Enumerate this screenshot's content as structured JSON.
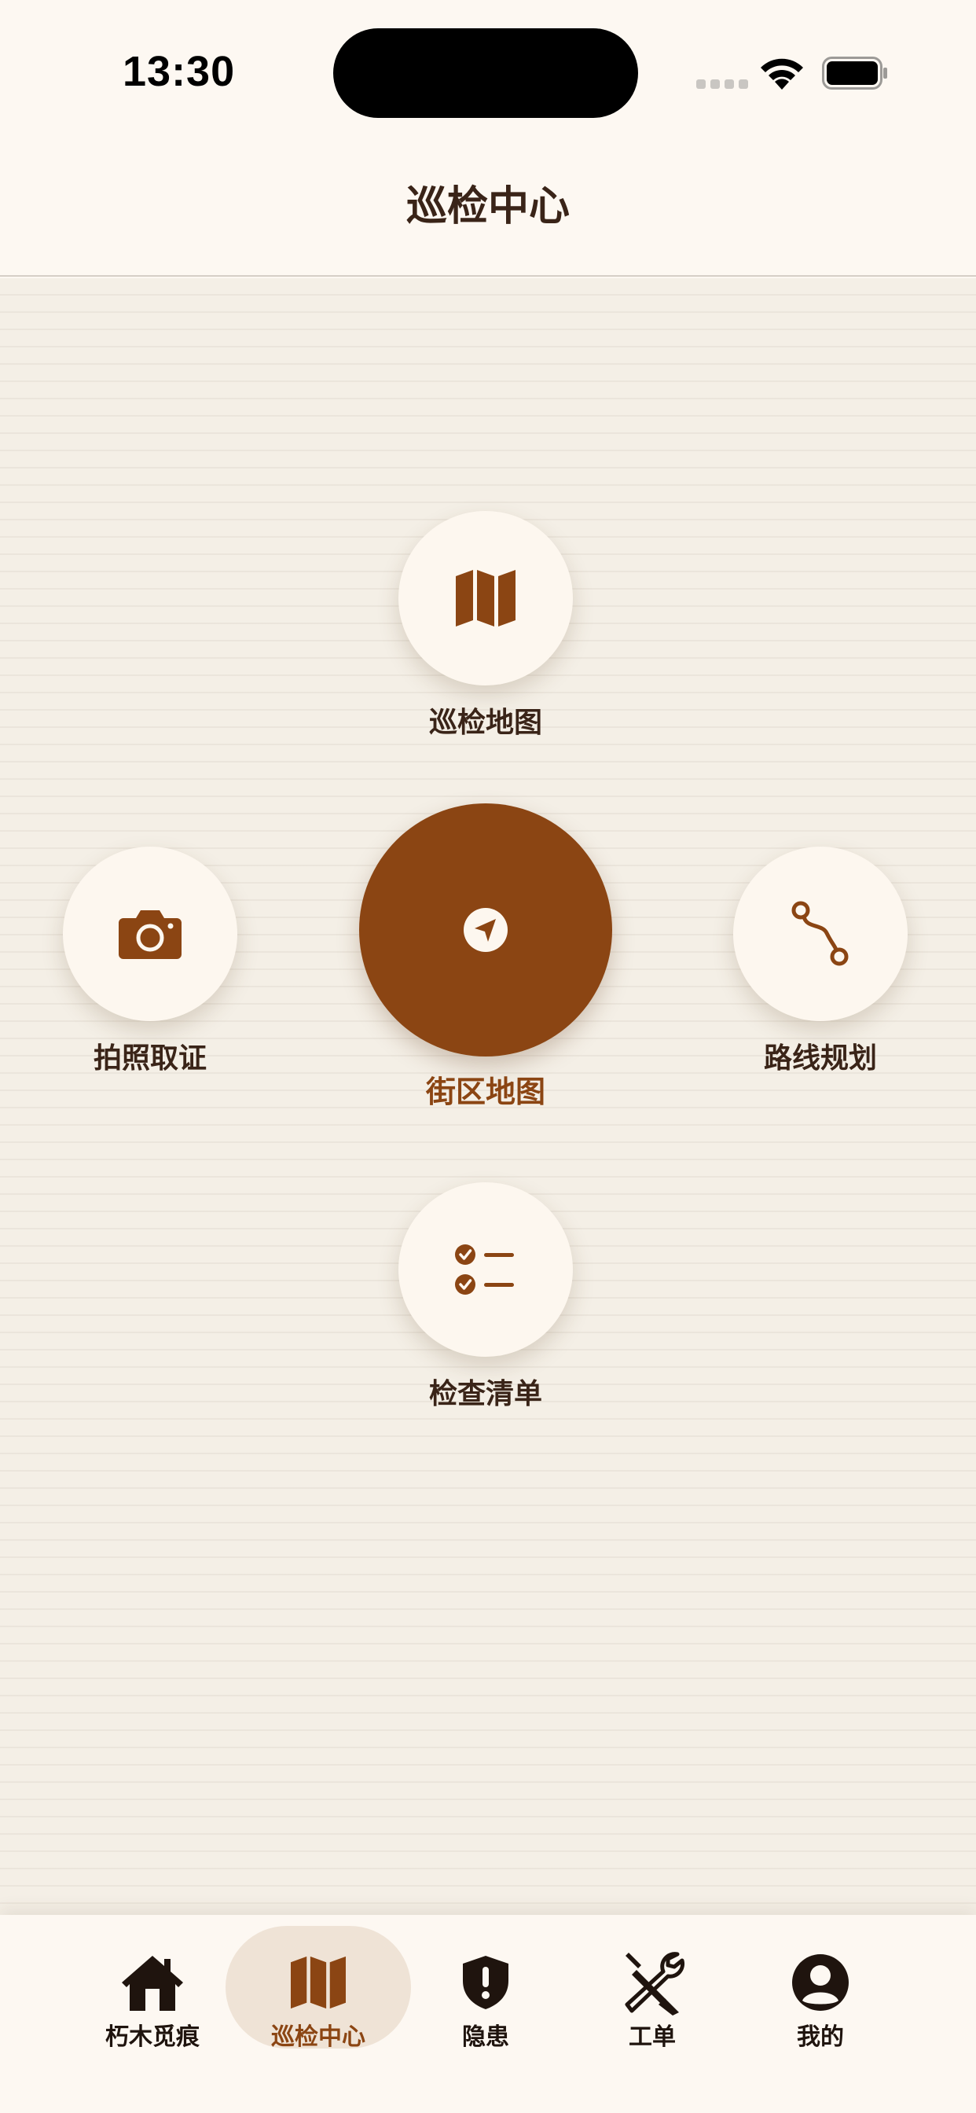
{
  "status_bar": {
    "time": "13:30",
    "wifi_icon": "wifi-icon",
    "battery_icon": "battery-icon"
  },
  "header": {
    "title": "巡检中心"
  },
  "actions": {
    "patrol_map": {
      "label": "巡检地图",
      "icon": "map-icon"
    },
    "photo_evidence": {
      "label": "拍照取证",
      "icon": "camera-icon"
    },
    "block_map": {
      "label": "街区地图",
      "icon": "location-arrow-icon"
    },
    "route_planning": {
      "label": "路线规划",
      "icon": "route-icon"
    },
    "checklist": {
      "label": "检查清单",
      "icon": "checklist-icon"
    }
  },
  "tabbar": {
    "active": "巡检中心",
    "items": [
      {
        "label": "朽木觅痕",
        "icon": "home-icon"
      },
      {
        "label": "巡检中心",
        "icon": "map-icon"
      },
      {
        "label": "隐患",
        "icon": "shield-alert-icon"
      },
      {
        "label": "工单",
        "icon": "tools-icon"
      },
      {
        "label": "我的",
        "icon": "user-icon"
      }
    ]
  },
  "colors": {
    "accent": "#8b4513",
    "background": "#fdf8f2",
    "text": "#3a2418"
  }
}
